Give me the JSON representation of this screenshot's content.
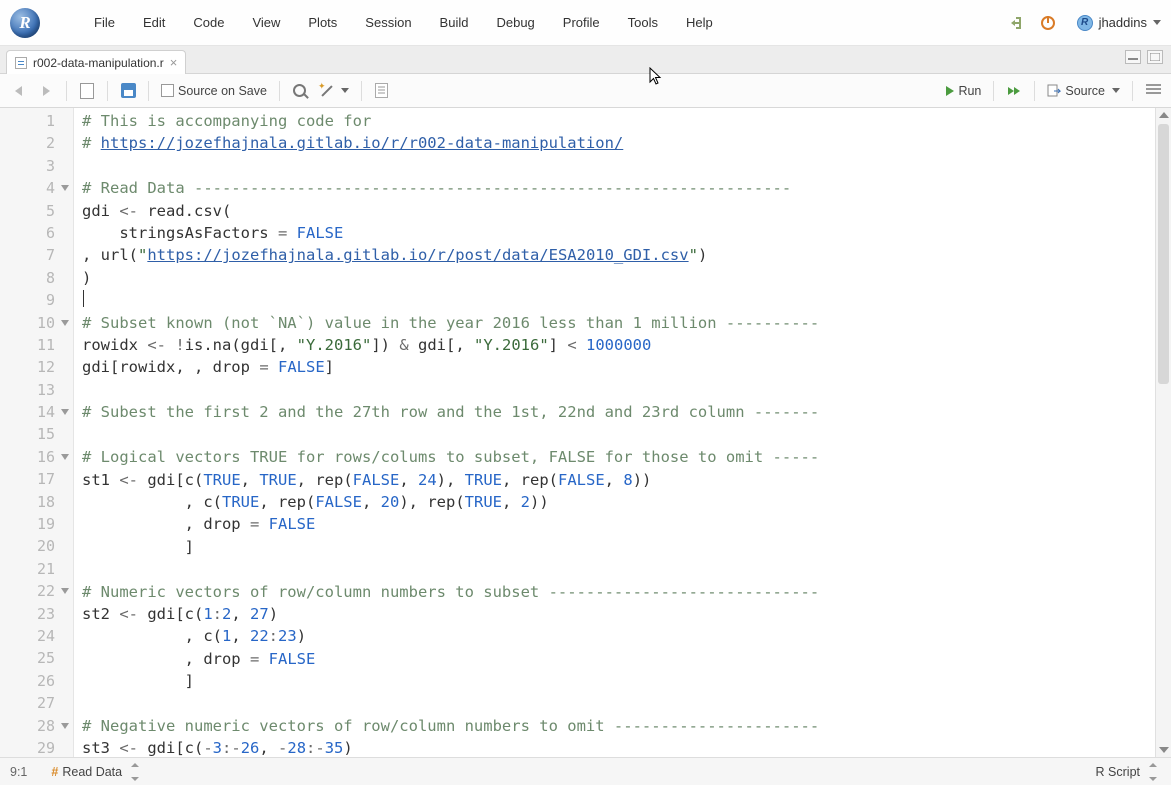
{
  "menubar": {
    "items": [
      "File",
      "Edit",
      "Code",
      "View",
      "Plots",
      "Session",
      "Build",
      "Debug",
      "Profile",
      "Tools",
      "Help"
    ],
    "user": "jhaddins"
  },
  "tab": {
    "filename": "r002-data-manipulation.r"
  },
  "toolbar": {
    "source_on_save": "Source on Save",
    "run": "Run",
    "source": "Source"
  },
  "statusbar": {
    "position": "9:1",
    "section": "Read Data",
    "lang": "R Script"
  },
  "code": {
    "lines": [
      {
        "n": 1,
        "seg": [
          [
            "cmt",
            "# This is accompanying code for"
          ]
        ]
      },
      {
        "n": 2,
        "seg": [
          [
            "cmt",
            "# "
          ],
          [
            "url",
            "https://jozefhajnala.gitlab.io/r/r002-data-manipulation/"
          ]
        ]
      },
      {
        "n": 3,
        "seg": []
      },
      {
        "n": 4,
        "fold": true,
        "seg": [
          [
            "cmt",
            "# Read Data ----------------------------------------------------------------"
          ]
        ]
      },
      {
        "n": 5,
        "seg": [
          [
            "",
            "gdi "
          ],
          [
            "op",
            "<-"
          ],
          [
            "",
            " read.csv("
          ]
        ]
      },
      {
        "n": 6,
        "seg": [
          [
            "",
            "    stringsAsFactors "
          ],
          [
            "op",
            "="
          ],
          [
            "",
            " "
          ],
          [
            "bool",
            "FALSE"
          ]
        ]
      },
      {
        "n": 7,
        "seg": [
          [
            "",
            ", url("
          ],
          [
            "str",
            "\""
          ],
          [
            "url",
            "https://jozefhajnala.gitlab.io/r/post/data/ESA2010_GDI.csv"
          ],
          [
            "str",
            "\""
          ],
          [
            "",
            ")"
          ]
        ]
      },
      {
        "n": 8,
        "seg": [
          [
            "",
            ")"
          ]
        ]
      },
      {
        "n": 9,
        "cursor": true,
        "seg": []
      },
      {
        "n": 10,
        "fold": true,
        "seg": [
          [
            "cmt",
            "# Subset known (not `NA`) value in the year 2016 less than 1 million ----------"
          ]
        ]
      },
      {
        "n": 11,
        "seg": [
          [
            "",
            "rowidx "
          ],
          [
            "op",
            "<-"
          ],
          [
            "",
            " "
          ],
          [
            "op",
            "!"
          ],
          [
            "",
            "is.na(gdi[, "
          ],
          [
            "str",
            "\"Y.2016\""
          ],
          [
            "",
            "]) "
          ],
          [
            "op",
            "&"
          ],
          [
            "",
            " gdi[, "
          ],
          [
            "str",
            "\"Y.2016\""
          ],
          [
            "",
            "] "
          ],
          [
            "op",
            "<"
          ],
          [
            "",
            " "
          ],
          [
            "num",
            "1000000"
          ]
        ]
      },
      {
        "n": 12,
        "seg": [
          [
            "",
            "gdi[rowidx, , drop "
          ],
          [
            "op",
            "="
          ],
          [
            "",
            " "
          ],
          [
            "bool",
            "FALSE"
          ],
          [
            "",
            "]"
          ]
        ]
      },
      {
        "n": 13,
        "seg": []
      },
      {
        "n": 14,
        "fold": true,
        "seg": [
          [
            "cmt",
            "# Subest the first 2 and the 27th row and the 1st, 22nd and 23rd column -------"
          ]
        ]
      },
      {
        "n": 15,
        "seg": []
      },
      {
        "n": 16,
        "fold": true,
        "seg": [
          [
            "cmt",
            "# Logical vectors TRUE for rows/colums to subset, FALSE for those to omit -----"
          ]
        ]
      },
      {
        "n": 17,
        "seg": [
          [
            "",
            "st1 "
          ],
          [
            "op",
            "<-"
          ],
          [
            "",
            " gdi[c("
          ],
          [
            "bool",
            "TRUE"
          ],
          [
            "",
            ", "
          ],
          [
            "bool",
            "TRUE"
          ],
          [
            "",
            ", rep("
          ],
          [
            "bool",
            "FALSE"
          ],
          [
            "",
            ", "
          ],
          [
            "num",
            "24"
          ],
          [
            "",
            "), "
          ],
          [
            "bool",
            "TRUE"
          ],
          [
            "",
            ", rep("
          ],
          [
            "bool",
            "FALSE"
          ],
          [
            "",
            ", "
          ],
          [
            "num",
            "8"
          ],
          [
            "",
            ")) "
          ]
        ]
      },
      {
        "n": 18,
        "seg": [
          [
            "",
            "           , c("
          ],
          [
            "bool",
            "TRUE"
          ],
          [
            "",
            ", rep("
          ],
          [
            "bool",
            "FALSE"
          ],
          [
            "",
            ", "
          ],
          [
            "num",
            "20"
          ],
          [
            "",
            "), rep("
          ],
          [
            "bool",
            "TRUE"
          ],
          [
            "",
            ", "
          ],
          [
            "num",
            "2"
          ],
          [
            "",
            "))"
          ]
        ]
      },
      {
        "n": 19,
        "seg": [
          [
            "",
            "           , drop "
          ],
          [
            "op",
            "="
          ],
          [
            "",
            " "
          ],
          [
            "bool",
            "FALSE"
          ]
        ]
      },
      {
        "n": 20,
        "seg": [
          [
            "",
            "           ]"
          ]
        ]
      },
      {
        "n": 21,
        "seg": []
      },
      {
        "n": 22,
        "fold": true,
        "seg": [
          [
            "cmt",
            "# Numeric vectors of row/column numbers to subset -----------------------------"
          ]
        ]
      },
      {
        "n": 23,
        "seg": [
          [
            "",
            "st2 "
          ],
          [
            "op",
            "<-"
          ],
          [
            "",
            " gdi[c("
          ],
          [
            "num",
            "1"
          ],
          [
            "op",
            ":"
          ],
          [
            "num",
            "2"
          ],
          [
            "",
            ", "
          ],
          [
            "num",
            "27"
          ],
          [
            "",
            ")"
          ]
        ]
      },
      {
        "n": 24,
        "seg": [
          [
            "",
            "           , c("
          ],
          [
            "num",
            "1"
          ],
          [
            "",
            ", "
          ],
          [
            "num",
            "22"
          ],
          [
            "op",
            ":"
          ],
          [
            "num",
            "23"
          ],
          [
            "",
            ")"
          ]
        ]
      },
      {
        "n": 25,
        "seg": [
          [
            "",
            "           , drop "
          ],
          [
            "op",
            "="
          ],
          [
            "",
            " "
          ],
          [
            "bool",
            "FALSE"
          ]
        ]
      },
      {
        "n": 26,
        "seg": [
          [
            "",
            "           ]"
          ]
        ]
      },
      {
        "n": 27,
        "seg": []
      },
      {
        "n": 28,
        "fold": true,
        "seg": [
          [
            "cmt",
            "# Negative numeric vectors of row/column numbers to omit ----------------------"
          ]
        ]
      },
      {
        "n": 29,
        "seg": [
          [
            "",
            "st3 "
          ],
          [
            "op",
            "<-"
          ],
          [
            "",
            " gdi[c("
          ],
          [
            "op",
            "-"
          ],
          [
            "num",
            "3"
          ],
          [
            "op",
            ":-"
          ],
          [
            "num",
            "26"
          ],
          [
            "",
            ", "
          ],
          [
            "op",
            "-"
          ],
          [
            "num",
            "28"
          ],
          [
            "op",
            ":-"
          ],
          [
            "num",
            "35"
          ],
          [
            "",
            ")"
          ]
        ]
      }
    ]
  }
}
